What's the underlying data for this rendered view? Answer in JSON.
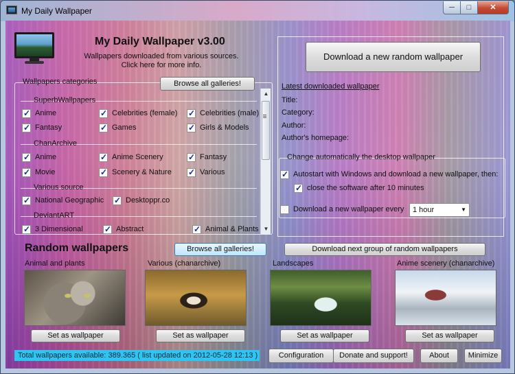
{
  "window": {
    "title": "My Daily Wallpaper",
    "controls": {
      "minimize": "─",
      "maximize": "□",
      "close": "✕"
    }
  },
  "header": {
    "title": "My Daily Wallpaper v3.00",
    "subtitle_line1": "Wallpapers downloaded from various sources.",
    "subtitle_line2": "Click here for more info."
  },
  "categories": {
    "legend": "Wallpapers categories",
    "browse_all": "Browse all galleries!",
    "sections": [
      {
        "name": "SuperbWallpapers",
        "items": [
          {
            "label": "Anime",
            "checked": true
          },
          {
            "label": "Celebrities (female)",
            "checked": true
          },
          {
            "label": "Celebrities (male)",
            "checked": true
          },
          {
            "label": "Fantasy",
            "checked": true
          },
          {
            "label": "Games",
            "checked": true
          },
          {
            "label": "Girls & Models",
            "checked": true
          }
        ]
      },
      {
        "name": "ChanArchive",
        "items": [
          {
            "label": "Anime",
            "checked": true
          },
          {
            "label": "Anime Scenery",
            "checked": true
          },
          {
            "label": "Fantasy",
            "checked": true
          },
          {
            "label": "Movie",
            "checked": true
          },
          {
            "label": "Scenery & Nature",
            "checked": true
          },
          {
            "label": "Various",
            "checked": true
          }
        ]
      },
      {
        "name": "Various source",
        "items": [
          {
            "label": "National Geographic",
            "checked": true
          },
          {
            "label": "Desktoppr.co",
            "checked": true
          }
        ]
      },
      {
        "name": "DeviantART",
        "items": [
          {
            "label": "3 Dimensional",
            "checked": true
          },
          {
            "label": "Abstract",
            "checked": true
          },
          {
            "label": "Animal & Plants",
            "checked": true
          }
        ]
      }
    ]
  },
  "download_random": "Download a new random wallpaper",
  "latest": {
    "link": "Latest downloaded wallpaper",
    "title_label": "Title:",
    "category_label": "Category:",
    "author_label": "Author:",
    "homepage_label": "Author's homepage:"
  },
  "auto": {
    "legend": "Change automatically the desktop wallpaper",
    "autostart": "Autostart with Windows and download a new wallpaper, then:",
    "autostart_checked": true,
    "close_after": "close the software after 10 minutes",
    "close_checked": true,
    "every": "Download a new wallpaper every",
    "every_checked": false,
    "interval": "1 hour"
  },
  "random": {
    "title": "Random wallpapers",
    "browse_all": "Browse all galleries!",
    "next_group": "Download next group of random wallpapers",
    "set_label": "Set as wallpaper",
    "items": [
      {
        "label": "Animal and plants"
      },
      {
        "label": "Various (chanarchive)"
      },
      {
        "label": "Landscapes"
      },
      {
        "label": "Anime scenery (chanarchive)"
      }
    ]
  },
  "footer": {
    "status": "Total wallpapers available: 389.365 ( list updated on 2012-05-28 12:13 )",
    "configuration": "Configuration",
    "donate": "Donate and support!",
    "about": "About",
    "minimize": "Minimize"
  }
}
